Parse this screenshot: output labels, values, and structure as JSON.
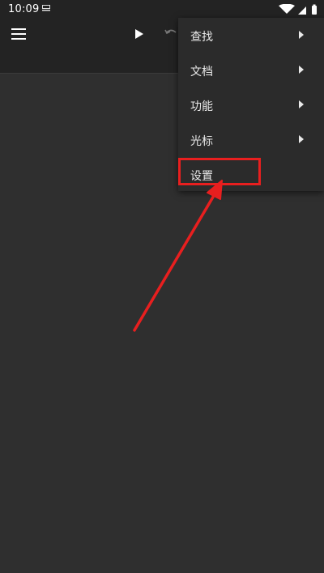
{
  "status_bar": {
    "time": "10:09",
    "icons": [
      "notification-icon",
      "wifi-icon",
      "signal-icon",
      "battery-icon"
    ]
  },
  "toolbar": {
    "icons": [
      "menu-icon",
      "play-icon",
      "undo-icon"
    ]
  },
  "menu": {
    "items": [
      {
        "label": "查找",
        "has_submenu": true
      },
      {
        "label": "文档",
        "has_submenu": true
      },
      {
        "label": "功能",
        "has_submenu": true
      },
      {
        "label": "光标",
        "has_submenu": true
      },
      {
        "label": "设置",
        "has_submenu": false
      }
    ]
  },
  "annotation": {
    "highlight_color": "#e81f1f",
    "target": "settings"
  },
  "colors": {
    "background": "#2f2f2f",
    "toolbar": "#232323",
    "menu": "#2b2b2b",
    "text": "#e9e9e9"
  }
}
